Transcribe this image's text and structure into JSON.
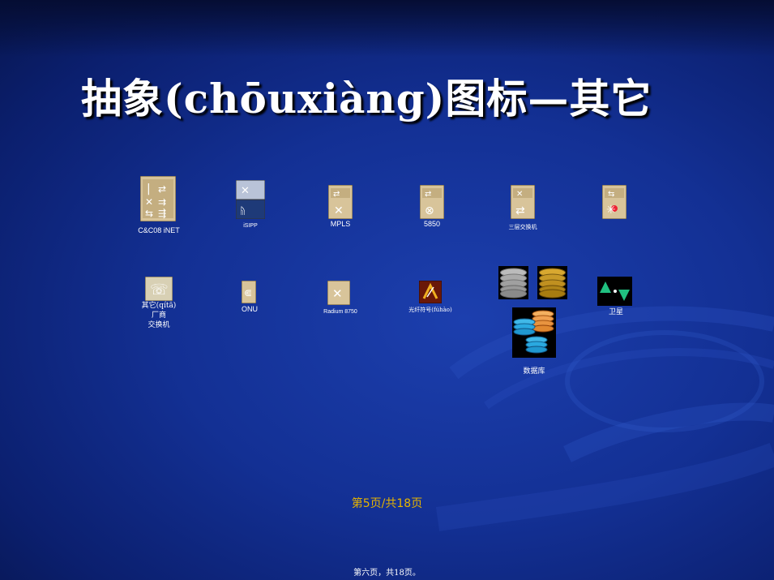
{
  "title": "抽象(chōuxiàng)图标—其它",
  "icons": {
    "cc08": "C&C08 iNET",
    "isipp": "iSIPP",
    "mpls": "MPLS",
    "n5850": "5850",
    "l3switch": "三层交换机",
    "other_line1": "其它(qítā)",
    "other_line2": "厂商",
    "other_line3": "交换机",
    "onu": "ONU",
    "radium": "Radium 8750",
    "fiber": "光纤符号(fúhào)",
    "satellite": "卫星",
    "database": "数据库"
  },
  "page_number": "第5页/共18页",
  "footer": "第六页，共18页。",
  "colors": {
    "background": "#133094",
    "page_number": "#e6b400",
    "icon_tan": "#d8c49a",
    "icon_gold": "#c8a23a",
    "db_orange": "#f0a050",
    "db_blue": "#2aa9e0"
  }
}
